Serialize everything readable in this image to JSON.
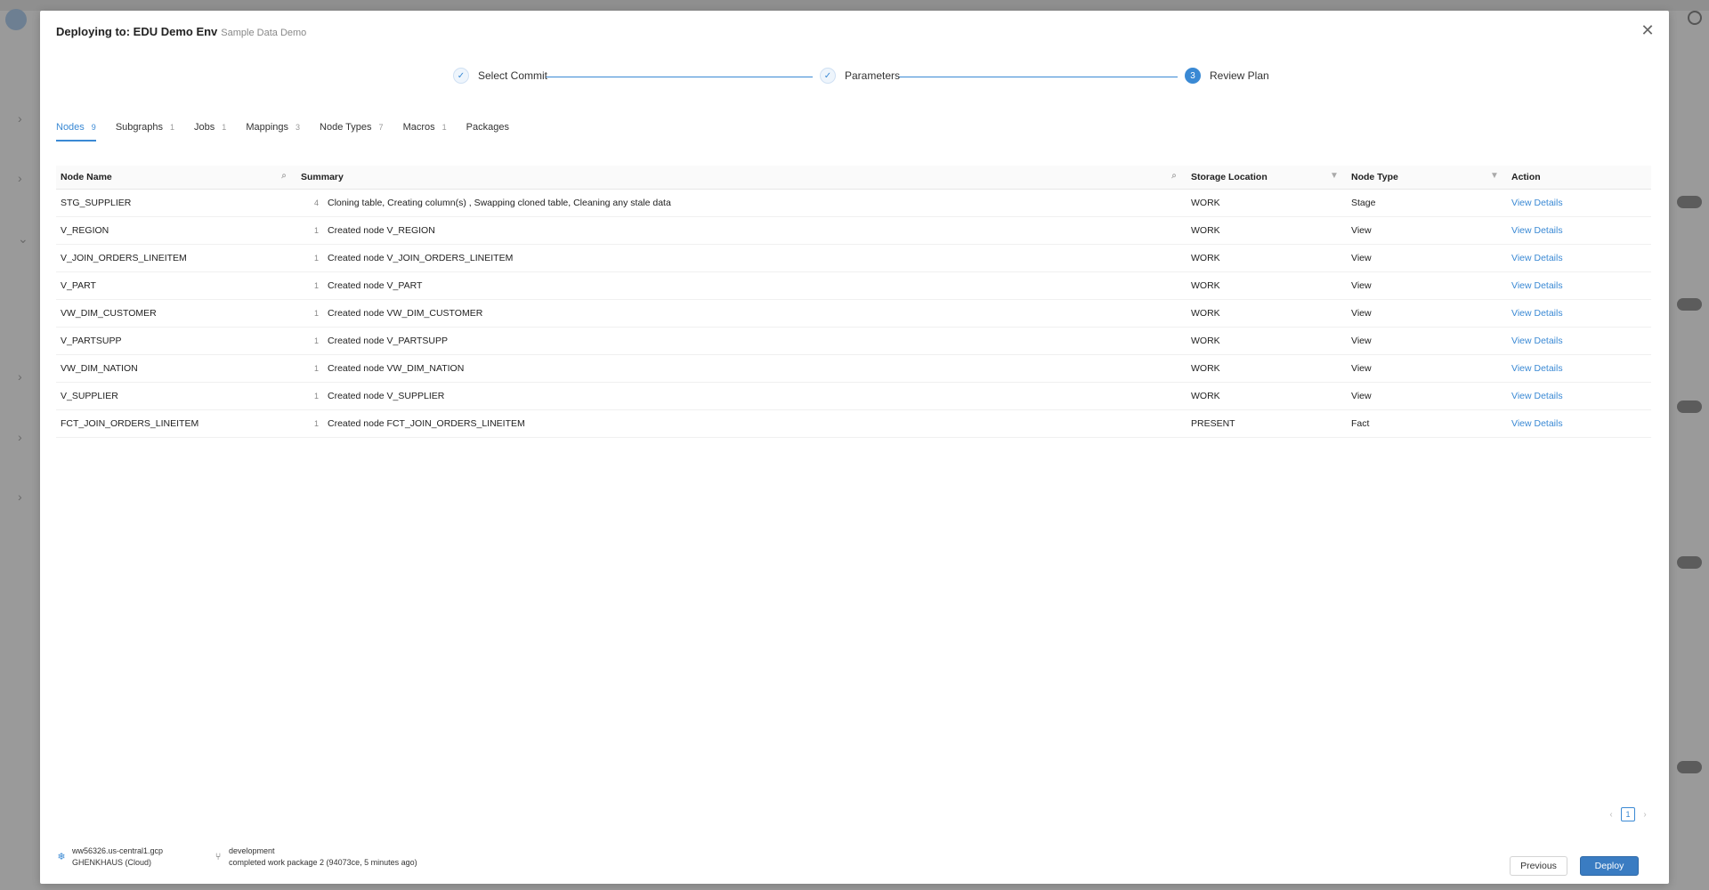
{
  "modal": {
    "title": "Deploying to: EDU Demo Env",
    "subtitle": "Sample Data Demo",
    "close_glyph": "✕"
  },
  "stepper": {
    "steps": [
      {
        "label": "Select Commit",
        "state": "done",
        "glyph": "✓"
      },
      {
        "label": "Parameters",
        "state": "done",
        "glyph": "✓"
      },
      {
        "label": "Review Plan",
        "state": "active",
        "glyph": "3"
      }
    ]
  },
  "tabs": [
    {
      "label": "Nodes",
      "count": "9",
      "active": true
    },
    {
      "label": "Subgraphs",
      "count": "1"
    },
    {
      "label": "Jobs",
      "count": "1"
    },
    {
      "label": "Mappings",
      "count": "3"
    },
    {
      "label": "Node Types",
      "count": "7"
    },
    {
      "label": "Macros",
      "count": "1"
    },
    {
      "label": "Packages",
      "count": ""
    }
  ],
  "table": {
    "columns": {
      "name": "Node Name",
      "summary": "Summary",
      "storage": "Storage Location",
      "type": "Node Type",
      "action": "Action"
    },
    "rows": [
      {
        "name": "STG_SUPPLIER",
        "count": "4",
        "summary": "Cloning table, Creating column(s) , Swapping cloned table, Cleaning any stale data",
        "storage": "WORK",
        "type": "Stage",
        "action": "View Details"
      },
      {
        "name": "V_REGION",
        "count": "1",
        "summary": "Created node V_REGION",
        "storage": "WORK",
        "type": "View",
        "action": "View Details"
      },
      {
        "name": "V_JOIN_ORDERS_LINEITEM",
        "count": "1",
        "summary": "Created node V_JOIN_ORDERS_LINEITEM",
        "storage": "WORK",
        "type": "View",
        "action": "View Details"
      },
      {
        "name": "V_PART",
        "count": "1",
        "summary": "Created node V_PART",
        "storage": "WORK",
        "type": "View",
        "action": "View Details"
      },
      {
        "name": "VW_DIM_CUSTOMER",
        "count": "1",
        "summary": "Created node VW_DIM_CUSTOMER",
        "storage": "WORK",
        "type": "View",
        "action": "View Details"
      },
      {
        "name": "V_PARTSUPP",
        "count": "1",
        "summary": "Created node V_PARTSUPP",
        "storage": "WORK",
        "type": "View",
        "action": "View Details"
      },
      {
        "name": "VW_DIM_NATION",
        "count": "1",
        "summary": "Created node VW_DIM_NATION",
        "storage": "WORK",
        "type": "View",
        "action": "View Details"
      },
      {
        "name": "V_SUPPLIER",
        "count": "1",
        "summary": "Created node V_SUPPLIER",
        "storage": "WORK",
        "type": "View",
        "action": "View Details"
      },
      {
        "name": "FCT_JOIN_ORDERS_LINEITEM",
        "count": "1",
        "summary": "Created node FCT_JOIN_ORDERS_LINEITEM",
        "storage": "PRESENT",
        "type": "Fact",
        "action": "View Details"
      }
    ]
  },
  "pagination": {
    "prev": "‹",
    "current": "1",
    "next": "›"
  },
  "footer": {
    "connection_host": "ww56326.us-central1.gcp",
    "connection_user": "GHENKHAUS (Cloud)",
    "branch": "development",
    "commit": "completed work package 2 (94073ce, 5 minutes ago)",
    "prev_label": "Previous",
    "deploy_label": "Deploy"
  },
  "colors": {
    "accent": "#3a89d4",
    "deploy": "#3a7cc2"
  }
}
